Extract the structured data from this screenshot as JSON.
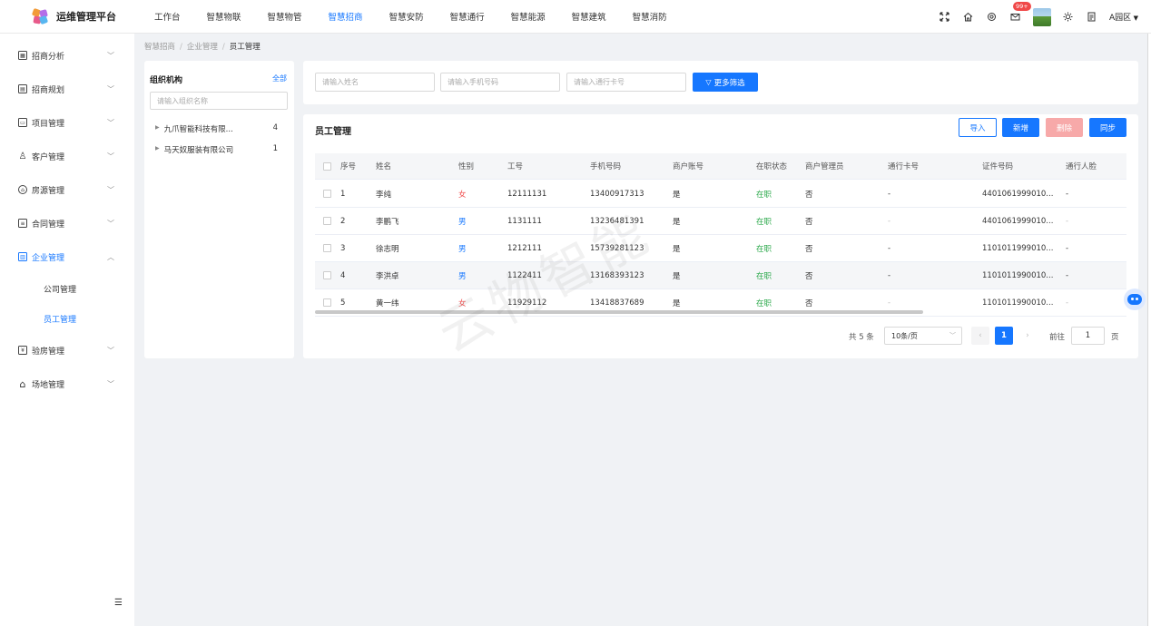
{
  "app": {
    "title": "运维管理平台"
  },
  "topnav": [
    "工作台",
    "智慧物联",
    "智慧物管",
    "智慧招商",
    "智慧安防",
    "智慧通行",
    "智慧能源",
    "智慧建筑",
    "智慧消防"
  ],
  "topnav_active": "智慧招商",
  "header": {
    "badge": "99+",
    "region": "A园区",
    "icons": [
      "fullscreen-icon",
      "home-icon",
      "settings-icon",
      "mail-icon",
      "sun-icon",
      "document-icon"
    ]
  },
  "sidebar": {
    "items": [
      {
        "label": "招商分析",
        "icon": "chart-icon"
      },
      {
        "label": "招商规划",
        "icon": "plan-icon"
      },
      {
        "label": "项目管理",
        "icon": "folder-icon"
      },
      {
        "label": "客户管理",
        "icon": "user-icon"
      },
      {
        "label": "房源管理",
        "icon": "house-icon"
      },
      {
        "label": "合同管理",
        "icon": "contract-icon"
      },
      {
        "label": "企业管理",
        "icon": "enterprise-icon",
        "open": true
      },
      {
        "label": "验房管理",
        "icon": "inspect-icon"
      },
      {
        "label": "场地管理",
        "icon": "venue-icon"
      }
    ],
    "sub_items": [
      "公司管理",
      "员工管理"
    ],
    "active_sub": "员工管理"
  },
  "breadcrumb": [
    "智慧招商",
    "企业管理",
    "员工管理"
  ],
  "org": {
    "title": "组织机构",
    "all_label": "全部",
    "search_placeholder": "请输入组织名称",
    "nodes": [
      {
        "name": "九爪智能科技有限...",
        "count": "4"
      },
      {
        "name": "马天奴服装有限公司",
        "count": "1"
      }
    ]
  },
  "filters": {
    "name_placeholder": "请输入姓名",
    "phone_placeholder": "请输入手机号码",
    "card_placeholder": "请输入通行卡号",
    "more_label": "更多筛选"
  },
  "main": {
    "title": "员工管理",
    "buttons": {
      "import": "导入",
      "new": "新增",
      "delete": "删除",
      "sync": "同步"
    }
  },
  "table": {
    "columns": [
      "序号",
      "姓名",
      "性别",
      "工号",
      "手机号码",
      "商户账号",
      "在职状态",
      "商户管理员",
      "通行卡号",
      "证件号码",
      "通行人脸"
    ],
    "rows": [
      [
        "1",
        "李纯",
        "女",
        "12111131",
        "13400917313",
        "是",
        "在职",
        "否",
        "-",
        "4401061999010...",
        "-"
      ],
      [
        "2",
        "李鹏飞",
        "男",
        "1131111",
        "13236481391",
        "是",
        "在职",
        "否",
        "-",
        "4401061999010...",
        "-"
      ],
      [
        "3",
        "徐志明",
        "男",
        "1212111",
        "15739281123",
        "是",
        "在职",
        "否",
        "-",
        "1101011999010...",
        "-"
      ],
      [
        "4",
        "李洪卓",
        "男",
        "1122411",
        "13168393123",
        "是",
        "在职",
        "否",
        "-",
        "1101011990010...",
        "-"
      ],
      [
        "5",
        "黄一纬",
        "女",
        "11929112",
        "13418837689",
        "是",
        "在职",
        "否",
        "-",
        "1101011990010...",
        "-"
      ]
    ],
    "highlight_row": 4
  },
  "pagination": {
    "total": "共 5 条",
    "page_size": "10条/页",
    "current": "1",
    "goto_label": "前往",
    "goto_value": "1",
    "page_unit": "页"
  },
  "watermark": "云物智能",
  "colors": {
    "accent": "#1677ff",
    "female": "#f04848",
    "active_status": "#2aa84a",
    "delete": "#f7a9a9"
  }
}
